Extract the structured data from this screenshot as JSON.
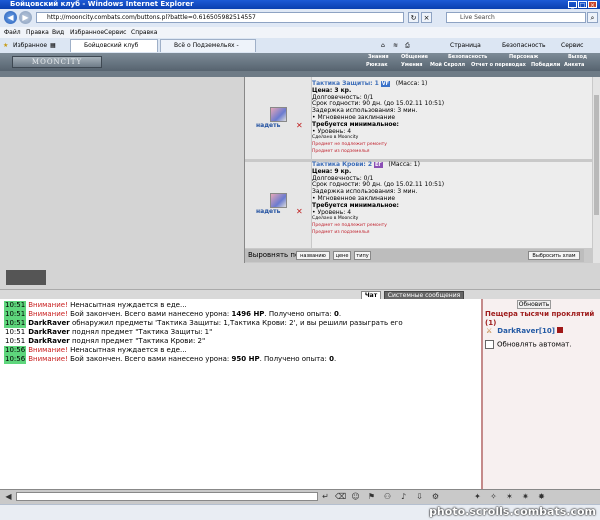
{
  "window": {
    "title": "Бойцовский клуб - Windows Internet Explorer"
  },
  "browser": {
    "url": "http://mooncity.combats.com/buttons.pl?battle=0.616505982514557",
    "search_placeholder": "Live Search",
    "menu": [
      "Файл",
      "Правка",
      "Вид",
      "Избранное",
      "Сервис",
      "Справка"
    ],
    "favorites": "Избранное",
    "tabs": [
      "Бойцовский клуб",
      "Всё о Подземельях - DarkCl..."
    ],
    "right_tools": [
      "Страница",
      "Безопасность",
      "Сервис"
    ]
  },
  "game_header": {
    "logo": "MOONCITY",
    "nav_top": [
      "Знания",
      "Общение",
      "Безопасность",
      "Персонаж",
      "Выход"
    ],
    "nav_bottom": [
      "Рюкзак",
      "Умения",
      "Мой Скролл",
      "Отчет о переводах",
      "Победили",
      "Анкета"
    ]
  },
  "inventory": {
    "top_partial": "...",
    "items": [
      {
        "put_label": "надеть",
        "name": "Тактика Защиты: 1",
        "tag": "VF",
        "tag_color": "#3a72c9",
        "mass": "(Масса: 1)",
        "price": "Цена: 3 кр.",
        "durability": "Долговечность: 0/1",
        "expiry": "Срок годности: 90 дн. (до 15.02.11 10:51)",
        "delay": "Задержка использования: 3 мин.",
        "instant": "• Мгновенное заклинание",
        "req_title": "Требуется минимальное:",
        "req_level": "• Уровень: 4",
        "made_in": "Сделано в Mooncity",
        "note1": "Предмет не подлежит ремонту",
        "note2": "Предмет из подземелья"
      },
      {
        "put_label": "надеть",
        "name": "Тактика Крови: 2",
        "tag": "ЕГ",
        "tag_color": "#8b4fb5",
        "mass": "(Масса: 1)",
        "price": "Цена: 9 кр.",
        "durability": "Долговечность: 0/1",
        "expiry": "Срок годности: 90 дн. (до 15.02.11 10:51)",
        "delay": "Задержка использования: 3 мин.",
        "instant": "• Мгновенное заклинание",
        "req_title": "Требуется минимальное:",
        "req_level": "• Уровень: 4",
        "made_in": "Сделано в Mooncity",
        "note1": "Предмет не подлежит ремонту",
        "note2": "Предмет из подземелья"
      }
    ],
    "sort_label": "Выровнять по",
    "sort_buttons": [
      "названию",
      "цене",
      "типу"
    ],
    "discard_button": "Выбросить хлам"
  },
  "chat_tabs": {
    "chat": "Чат",
    "system": "Системные сообщения"
  },
  "chat": [
    {
      "time": "10:51",
      "hl": true,
      "warn": "Внимание!",
      "text": "Ненасытная нуждается в еде..."
    },
    {
      "time": "10:51",
      "hl": true,
      "warn": "Внимание!",
      "pre": "Бой закончен. Всего вами нанесено урона: ",
      "bold": "1496 HP",
      "post": ". Получено опыта: ",
      "bold2": "0",
      "end": "."
    },
    {
      "time": "10:51",
      "hl": true,
      "who": "DarkRaver",
      "text": "обнаружил предметы 'Тактика Защиты: 1,Тактика Крови: 2', и вы решили разыграть его"
    },
    {
      "time": "10:51",
      "hl": false,
      "who": "DarkRaver",
      "text": "поднял предмет \"Тактика Защиты: 1\""
    },
    {
      "time": "10:51",
      "hl": false,
      "who": "DarkRaver",
      "text": "поднял предмет \"Тактика Крови: 2\""
    },
    {
      "time": "10:56",
      "hl": true,
      "warn": "Внимание!",
      "text": "Ненасытная нуждается в еде..."
    },
    {
      "time": "10:56",
      "hl": true,
      "warn": "Внимание!",
      "pre": "Бой закончен. Всего вами нанесено урона: ",
      "bold": "950 HP",
      "post": ". Получено опыта: ",
      "bold2": "0",
      "end": "."
    }
  ],
  "right_panel": {
    "refresh": "Обновить",
    "location": "Пещера тысячи проклятий (1)",
    "player": "DarkRaver",
    "player_level": "[10]",
    "auto_refresh": "Обновлять автомат."
  },
  "watermark": "photo.scrolls.combats.com"
}
